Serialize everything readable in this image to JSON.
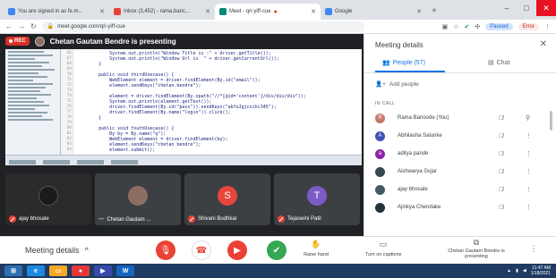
{
  "browser": {
    "tabs": [
      {
        "label": "You are signed in as fe.m...",
        "color": "#4285f4"
      },
      {
        "label": "Inbox (3,452) - rama.banc...",
        "color": "#ea4335"
      },
      {
        "label": "Meet - qri-yiff-cue",
        "color": "#00897b",
        "active": true
      },
      {
        "label": "Google",
        "color": "#4285f4"
      }
    ],
    "url": "meet.google.com/qri-yiff-cue",
    "paused_label": "Paused",
    "error_label": "Error"
  },
  "meet": {
    "rec_label": "REC",
    "presenting_text": "Chetan Gautam Bendre is presenting",
    "code_lines": [
      "            System.out.println(\"Window Title is :\" + driver.getTitle());",
      "            System.out.println(\"Window Url is  \" + driver.getCurrentUrl());",
      "        }",
      "",
      "        public void thirdUsecase() {",
      "            WebElement element = driver.findElement(By.id(\"email\"));",
      "            element.sendKeys(\"chetan.bendre\");",
      "",
      "            element = driver.findElement(By.xpath(\"//*[@id='content']/div/div/div\"));",
      "            System.out.println(element.getText());",
      "            driver.findElement(By.id(\"pass\")).sendKeys(\"akfuJgjcsihc345\");",
      "            driver.findElement(By.name(\"login\")).click();",
      "        }",
      "",
      "        public void fouthUsecase() {",
      "            By by = By.name(\"q\");",
      "            WebElement element = driver.findElement(by);",
      "            element.sendKeys(\"chetan bendre\");",
      "            element.submit();"
    ],
    "gutter_numbers": [
      "66",
      "67",
      "68",
      "69",
      "70",
      "71",
      "72",
      "73",
      "74",
      "75",
      "76",
      "77",
      "78",
      "79",
      "80",
      "81",
      "82",
      "83",
      "84"
    ],
    "tiles": [
      {
        "name": "ajay bhosale",
        "initial": "",
        "color": "#3c4043",
        "muted": true
      },
      {
        "name": "Chetan Gautam ...",
        "initial": "",
        "color": "#8d6e63",
        "muted": false,
        "dots": "•••"
      },
      {
        "name": "Shivani Budhkar",
        "initial": "S",
        "color": "#e8453c",
        "muted": true
      },
      {
        "name": "Tejaswini Patil",
        "initial": "T",
        "color": "#7b5cc7",
        "muted": true
      }
    ]
  },
  "controls": {
    "meeting_details": "Meeting details",
    "raise_hand": "Raise hand",
    "captions": "Turn on captions",
    "present": "Chetan Gautam Bendre is presenting"
  },
  "panel": {
    "title": "Meeting details",
    "people_tab": "People (57)",
    "chat_tab": "Chat",
    "add_people": "Add people",
    "in_call": "IN CALL",
    "people": [
      {
        "name": "Rama Banoode (You)",
        "initial": "R",
        "color": "#c4796b"
      },
      {
        "name": "Abhilasha Salunke",
        "initial": "A",
        "color": "#3f51b5"
      },
      {
        "name": "aditya pande",
        "initial": "a",
        "color": "#8e24aa"
      },
      {
        "name": "Aishwarya Gujar",
        "initial": "",
        "color": "#37474f"
      },
      {
        "name": "ajay bhosale",
        "initial": "",
        "color": "#455a64"
      },
      {
        "name": "Ajinkya Chendake",
        "initial": "",
        "color": "#263238"
      }
    ]
  },
  "taskbar": {
    "time": "11:47 AM",
    "date": "1/18/2021"
  }
}
